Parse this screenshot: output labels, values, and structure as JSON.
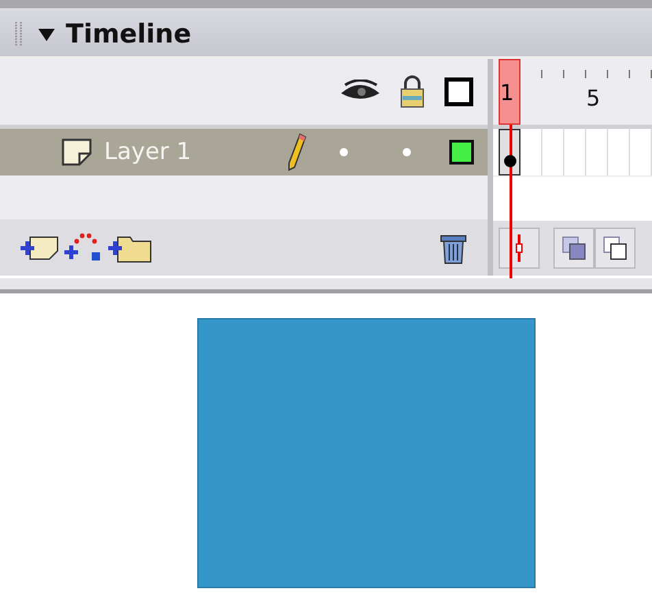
{
  "panel": {
    "title": "Timeline",
    "expanded": true
  },
  "frames": [
    {
      "label": "1",
      "current": true
    },
    {
      "current": false
    },
    {
      "current": false
    },
    {
      "current": false
    },
    {
      "label": "5",
      "current": false
    },
    {
      "current": false
    },
    {
      "current": false
    }
  ],
  "layers": [
    {
      "name": "Layer 1",
      "selected": true,
      "color": "#44ee44"
    }
  ]
}
